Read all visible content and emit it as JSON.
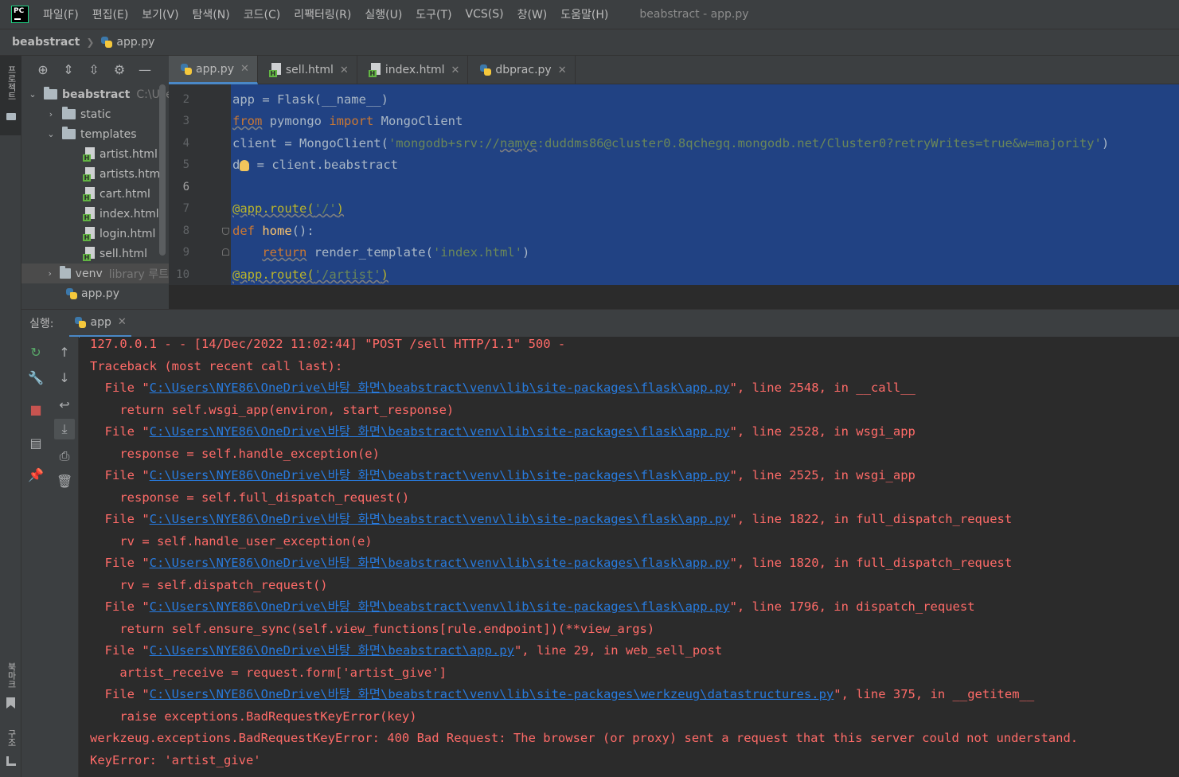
{
  "menubar": {
    "logo": "PC",
    "items": [
      "파일(F)",
      "편집(E)",
      "보기(V)",
      "탐색(N)",
      "코드(C)",
      "리팩터링(R)",
      "실행(U)",
      "도구(T)",
      "VCS(S)",
      "창(W)",
      "도움말(H)"
    ],
    "window_title": "beabstract - app.py"
  },
  "breadcrumb": {
    "project": "beabstract",
    "file": "app.py"
  },
  "left_stripe": {
    "project_label": "프로젝트",
    "bookmarks_label": "북마크",
    "structure_label": "구조"
  },
  "project_tree": {
    "root": {
      "name": "beabstract",
      "path": "C:\\Users"
    },
    "static": "static",
    "templates": "templates",
    "files": [
      "artist.html",
      "artists.html",
      "cart.html",
      "index.html",
      "login.html",
      "sell.html"
    ],
    "venv": {
      "name": "venv",
      "note": "library 루트"
    },
    "app_py": "app.py"
  },
  "editor_tabs": [
    "app.py",
    "sell.html",
    "index.html",
    "dbprac.py"
  ],
  "code": {
    "line_numbers": [
      "2",
      "3",
      "4",
      "5",
      "6",
      "7",
      "8",
      "9",
      "10"
    ],
    "l2": "app = Flask(__name__)",
    "l3_from": "from",
    "l3_mod": " pymongo ",
    "l3_import": "import",
    "l3_name": " MongoClient",
    "l4_pre": "client = MongoClient(",
    "l4_str_a": "'mongodb+srv://",
    "l4_str_b": "namye",
    "l4_str_c": ":duddms86@cluster0.8qchegq.mongodb.net/Cluster0?retryWrites=true&w=majority'",
    "l4_post": ")",
    "l5_a": "d",
    "l5_b": " = client.beabstract",
    "l7_deco": "@app.route(",
    "l7_str": "'/'",
    "l7_post": ")",
    "l8_def": "def",
    "l8_name": " home",
    "l8_post": "():",
    "l9_ret": "return",
    "l9_mid": " render_template(",
    "l9_str": "'index.html'",
    "l9_post": ")",
    "l10_deco": "@app.route(",
    "l10_str": "'/artist'",
    "l10_post": ")"
  },
  "run": {
    "label": "실행:",
    "tab": "app",
    "path_prefix": "C:\\Users\\NYE86\\OneDrive\\바탕 화면\\beabstract\\venv\\lib\\site-packages\\",
    "lines": {
      "l1": "127.0.0.1 - - [14/Dec/2022 11:02:44] \"POST /sell HTTP/1.1\" 500 -",
      "l2": "Traceback (most recent call last):",
      "f1_link": "C:\\Users\\NYE86\\OneDrive\\바탕 화면\\beabstract\\venv\\lib\\site-packages\\flask\\app.py",
      "f1_tail": "\", line 2548, in __call__",
      "c1": "    return self.wsgi_app(environ, start_response)",
      "f2_link": "C:\\Users\\NYE86\\OneDrive\\바탕 화면\\beabstract\\venv\\lib\\site-packages\\flask\\app.py",
      "f2_tail": "\", line 2528, in wsgi_app",
      "c2": "    response = self.handle_exception(e)",
      "f3_link": "C:\\Users\\NYE86\\OneDrive\\바탕 화면\\beabstract\\venv\\lib\\site-packages\\flask\\app.py",
      "f3_tail": "\", line 2525, in wsgi_app",
      "c3": "    response = self.full_dispatch_request()",
      "f4_link": "C:\\Users\\NYE86\\OneDrive\\바탕 화면\\beabstract\\venv\\lib\\site-packages\\flask\\app.py",
      "f4_tail": "\", line 1822, in full_dispatch_request",
      "c4": "    rv = self.handle_user_exception(e)",
      "f5_link": "C:\\Users\\NYE86\\OneDrive\\바탕 화면\\beabstract\\venv\\lib\\site-packages\\flask\\app.py",
      "f5_tail": "\", line 1820, in full_dispatch_request",
      "c5": "    rv = self.dispatch_request()",
      "f6_link": "C:\\Users\\NYE86\\OneDrive\\바탕 화면\\beabstract\\venv\\lib\\site-packages\\flask\\app.py",
      "f6_tail": "\", line 1796, in dispatch_request",
      "c6": "    return self.ensure_sync(self.view_functions[rule.endpoint])(**view_args)",
      "f7_link": "C:\\Users\\NYE86\\OneDrive\\바탕 화면\\beabstract\\app.py",
      "f7_tail": "\", line 29, in web_sell_post",
      "c7": "    artist_receive = request.form['artist_give']",
      "f8_link": "C:\\Users\\NYE86\\OneDrive\\바탕 화면\\beabstract\\venv\\lib\\site-packages\\werkzeug\\datastructures.py",
      "f8_tail": "\", line 375, in __getitem__",
      "c8": "    raise exceptions.BadRequestKeyError(key)",
      "err1": "werkzeug.exceptions.BadRequestKeyError: 400 Bad Request: The browser (or proxy) sent a request that this server could not understand.",
      "err2": "KeyError: 'artist_give'"
    },
    "file_prefix": "  File \""
  },
  "colors": {
    "error_text": "#ff6b68",
    "link": "#287bde",
    "selection": "#214283",
    "keyword": "#cc7832",
    "string": "#6a8759"
  }
}
